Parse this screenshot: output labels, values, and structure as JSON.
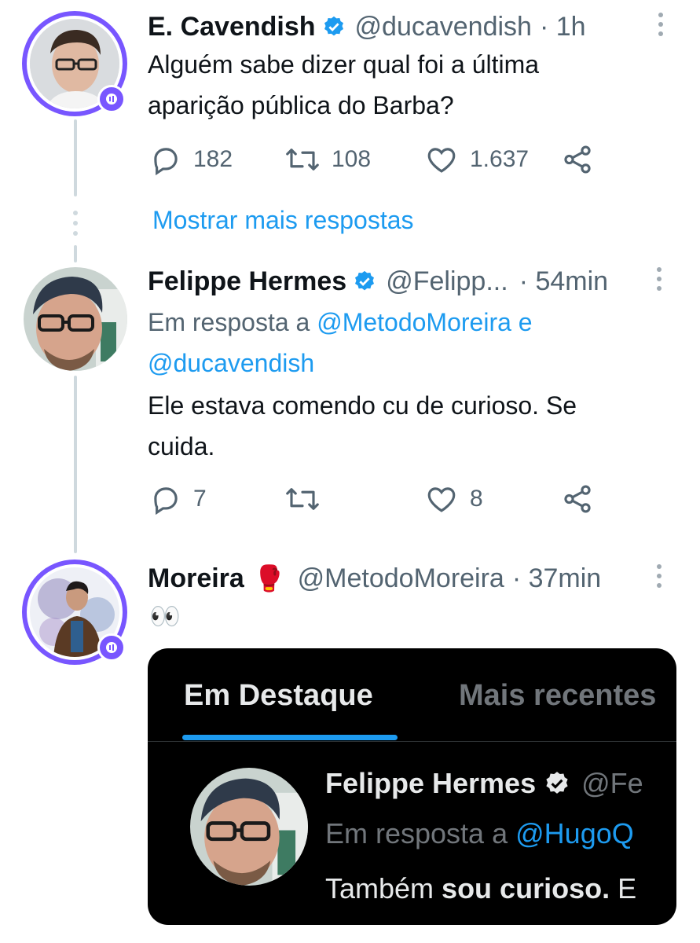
{
  "tweets": [
    {
      "name": "E. Cavendish",
      "handle": "@ducavendish",
      "time": "· 1h",
      "text_lines": [
        "Alguém sabe dizer qual foi a última",
        "aparição pública do Barba?"
      ],
      "replies": "182",
      "retweets": "108",
      "likes": "1.637"
    },
    {
      "name": "Felippe Hermes",
      "handle": "@Felipp...",
      "time": "· 54min",
      "reply_prefix": "Em resposta a",
      "reply_to_1": "@MetodoMoreira e",
      "reply_to_2": "@ducavendish",
      "text_lines": [
        "Ele estava comendo cu de curioso. Se",
        "cuida."
      ],
      "replies": "7",
      "retweets": "",
      "likes": "8"
    },
    {
      "name": "Moreira",
      "name_emoji": "🥊",
      "handle": "@MetodoMoreira",
      "time": "· 37min",
      "text": "👀"
    }
  ],
  "show_more": "Mostrar mais respostas",
  "embed": {
    "tab_active": "Em Destaque",
    "tab_inactive": "Mais recentes",
    "name": "Felippe Hermes",
    "handle": "@Fe",
    "reply_prefix": "Em resposta a",
    "reply_to": "@HugoQ",
    "text_start": "Também ",
    "text_bold": "sou curioso.",
    "text_end": " E"
  },
  "icons": [
    "reply-icon",
    "retweet-icon",
    "like-icon",
    "share-icon",
    "verified-icon",
    "more-icon",
    "space-badge-icon"
  ],
  "colors": {
    "accent": "#1d9bf0",
    "spaces_ring": "#7856ff",
    "muted": "#536471",
    "thread_line": "#cfd9de"
  }
}
